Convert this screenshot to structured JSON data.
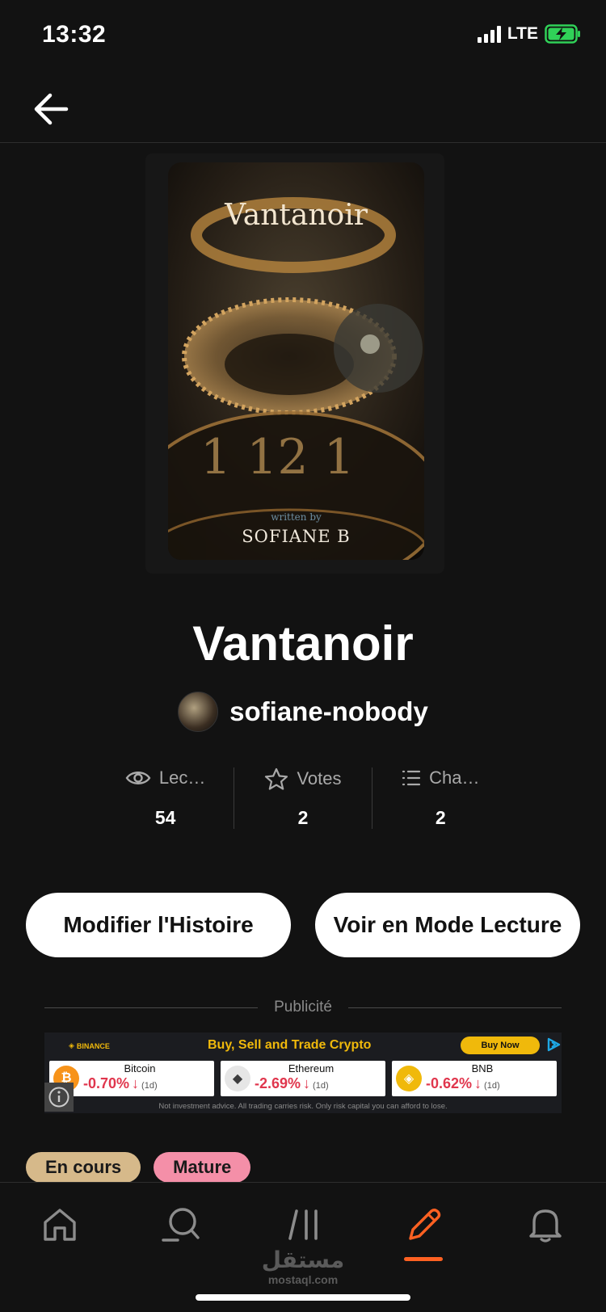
{
  "status_bar": {
    "time": "13:32",
    "network": "LTE"
  },
  "cover": {
    "title": "Vantanoir",
    "written_by": "written by",
    "author": "SOFIANE B"
  },
  "story": {
    "title": "Vantanoir",
    "author": "sofiane-nobody"
  },
  "stats": [
    {
      "label": "Lec…",
      "value": "54",
      "icon": "eye-icon"
    },
    {
      "label": "Votes",
      "value": "2",
      "icon": "star-icon"
    },
    {
      "label": "Cha…",
      "value": "2",
      "icon": "list-icon"
    }
  ],
  "actions": {
    "edit_label": "Modifier l'Histoire",
    "read_label": "Voir en Mode Lecture"
  },
  "ad": {
    "label": "Publicité",
    "brand": "BINANCE",
    "headline": "Buy, Sell and Trade Crypto",
    "cta": "Buy Now",
    "coins": [
      {
        "name": "Bitcoin",
        "change": "-0.70%",
        "period": "(1d)",
        "symbol": "₿",
        "color": "#f7931a"
      },
      {
        "name": "Ethereum",
        "change": "-2.69%",
        "period": "(1d)",
        "symbol": "◆",
        "color": "#3c3c3d"
      },
      {
        "name": "BNB",
        "change": "-0.62%",
        "period": "(1d)",
        "symbol": "◈",
        "color": "#f0b90b"
      }
    ],
    "disclaimer": "Not investment advice. All trading carries risk. Only risk capital you can afford to lose."
  },
  "tags": [
    {
      "label": "En cours",
      "color": "#d6b98a"
    },
    {
      "label": "Mature",
      "color": "#f48fa8"
    }
  ],
  "nav": {
    "active_color": "#ff6122",
    "watermark_ar": "مستقل",
    "watermark_en": "mostaql.com"
  }
}
